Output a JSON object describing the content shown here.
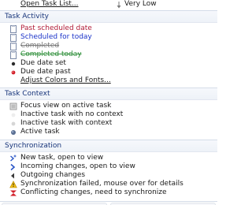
{
  "top": {
    "open_task_list_label": "Open Task List...",
    "priority_label": "Very Low"
  },
  "task_activity": {
    "header": "Task Activity",
    "items": [
      {
        "label": "Past scheduled date",
        "color": "#b11c38",
        "icon": "task-page-icon"
      },
      {
        "label": "Scheduled for today",
        "color": "#1b33c9",
        "icon": "task-page-icon"
      },
      {
        "label": "Completed",
        "color": "#777777",
        "icon": "task-page-icon"
      },
      {
        "label": "Completed today",
        "color": "#2f8f3a",
        "icon": "task-page-icon"
      },
      {
        "label": "Due date set",
        "color": "#1a1a1a",
        "icon": "due-date-dot-icon"
      },
      {
        "label": "Due date past",
        "color": "#1a1a1a",
        "icon": "overdue-dot-icon"
      }
    ],
    "adjust_link": "Adjust Colors and Fonts..."
  },
  "task_context": {
    "header": "Task Context",
    "items": [
      {
        "label": "Focus view on active task",
        "icon": "focus-view-icon"
      },
      {
        "label": "Inactive task with no context",
        "icon": "inactive-no-context-icon"
      },
      {
        "label": "Inactive task with context",
        "icon": "inactive-context-icon"
      },
      {
        "label": "Active task",
        "icon": "active-task-icon"
      }
    ]
  },
  "synchronization": {
    "header": "Synchronization",
    "items": [
      {
        "label": "New task, open to view",
        "icon": "new-task-icon"
      },
      {
        "label": "Incoming changes, open to view",
        "icon": "incoming-changes-icon"
      },
      {
        "label": "Outgoing changes",
        "icon": "outgoing-changes-icon"
      },
      {
        "label": "Synchronization failed, mouse over for details",
        "icon": "sync-failed-icon"
      },
      {
        "label": "Conflicting changes, need to synchronize",
        "icon": "conflict-icon"
      }
    ]
  },
  "colors": {
    "section_header_text": "#18357a",
    "past_scheduled": "#b11c38",
    "scheduled_today": "#1b33c9",
    "completed": "#777777",
    "completed_today": "#2f8f3a"
  }
}
